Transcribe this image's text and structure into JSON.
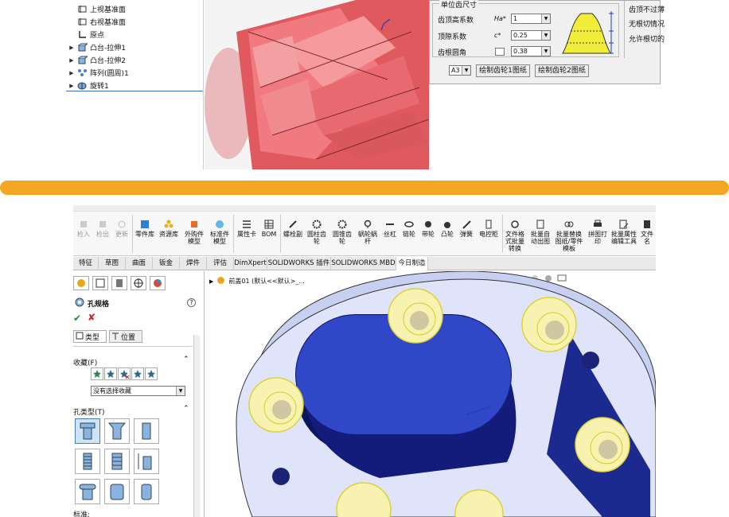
{
  "tree": {
    "items": [
      {
        "label": "上视基准面",
        "expand": ""
      },
      {
        "label": "右视基准面",
        "expand": ""
      },
      {
        "label": "原点",
        "expand": ""
      },
      {
        "label": "凸台-拉伸1",
        "expand": "▶"
      },
      {
        "label": "凸台-拉伸2",
        "expand": "▶"
      },
      {
        "label": "阵列(圆周)1",
        "expand": "▶"
      },
      {
        "label": "旋转1",
        "expand": "▶"
      }
    ]
  },
  "gear_dialog": {
    "group_title": "单位齿尺寸",
    "rows": [
      {
        "label": "齿顶高系数",
        "symbol": "Ha*",
        "value": "1"
      },
      {
        "label": "顶隙系数",
        "symbol": "c*",
        "value": "0.25"
      },
      {
        "label": "齿根圆角",
        "symbol": "",
        "value": "0.38"
      }
    ],
    "right_texts": [
      "齿顶不过薄",
      "无根切情况",
      "允许根切的"
    ],
    "paper_size": "A3",
    "btn_gear1": "绘制齿轮1图纸",
    "btn_gear2": "绘制齿轮2图纸"
  },
  "toolbar": {
    "disabled": [
      "检入",
      "检出",
      "更新"
    ],
    "items": [
      "零件库",
      "资源库",
      "外购件模型",
      "标准件模型",
      "属性卡",
      "BOM",
      "螺栓副",
      "圆柱齿轮",
      "圆锥齿轮",
      "蜗轮蜗杆",
      "丝杠",
      "链轮",
      "带轮",
      "凸轮",
      "弹簧",
      "电控柜",
      "文件格式批量转换",
      "批量自动出图",
      "批量替换图纸/零件模板",
      "拼图打印",
      "批量属性编辑工具",
      "文件名"
    ]
  },
  "tabs": [
    "特征",
    "草图",
    "曲面",
    "钣金",
    "焊件",
    "评估",
    "DimXpert",
    "SOLIDWORKS 插件",
    "SOLIDWORKS MBD",
    "今日制造"
  ],
  "property_manager": {
    "title": "孔规格",
    "tab_type": "类型",
    "tab_position": "位置",
    "favorites_label": "收藏(F)",
    "favorites_value": "没有选择收藏",
    "hole_type_label": "孔类型(T)",
    "standard_label": "标准:"
  },
  "view": {
    "breadcrumb": "前盖01 (默认<<默认>_..."
  },
  "colors": {
    "divider": "#f5a623",
    "gear": "#e8747a",
    "part_blue": "#2c3fb8",
    "hole_yellow": "#f2ec3a"
  }
}
